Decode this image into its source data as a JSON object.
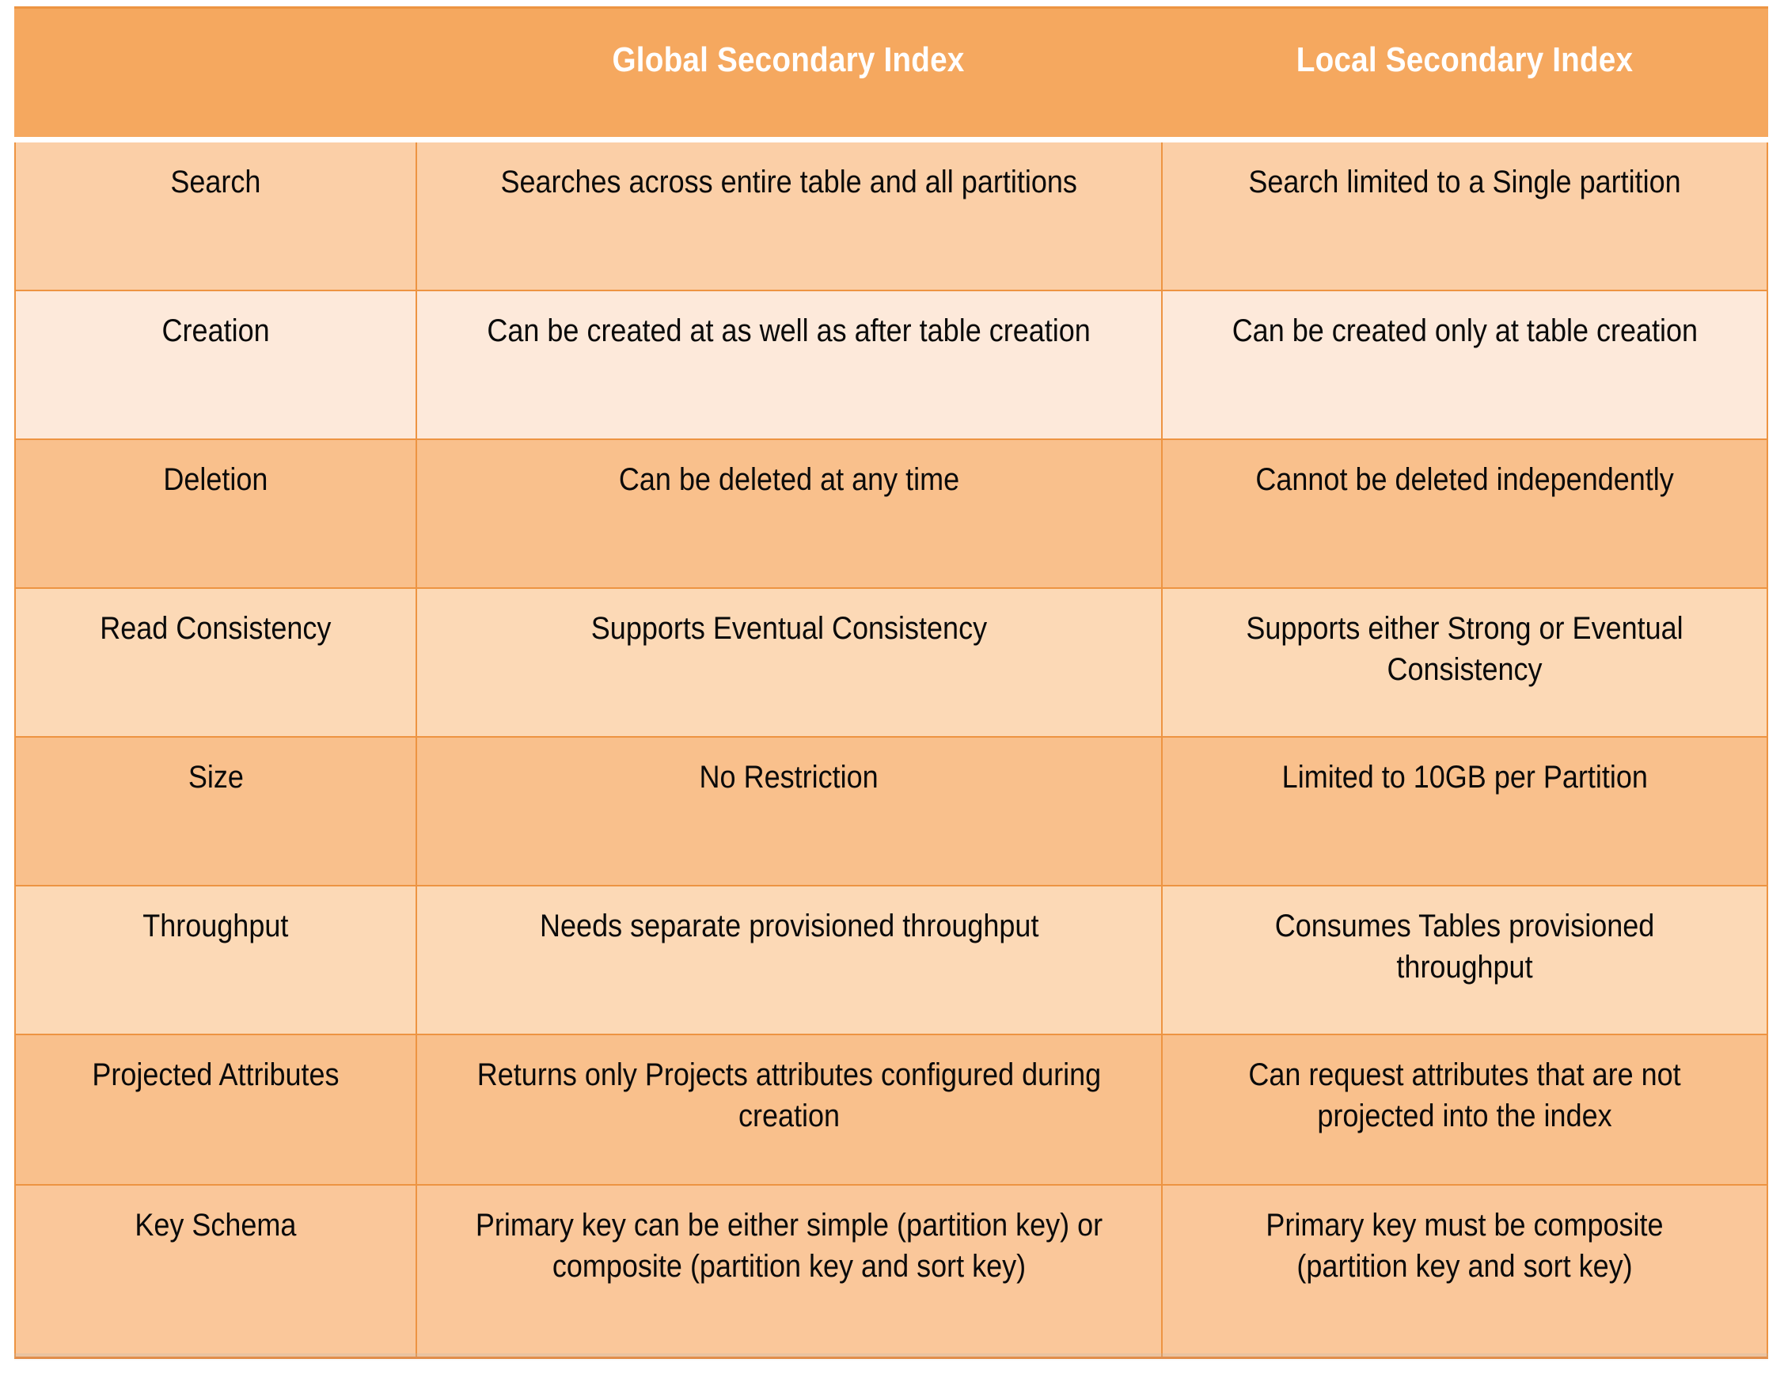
{
  "table": {
    "columns": [
      {
        "key": "feature",
        "label": ""
      },
      {
        "key": "gsi",
        "label": "Global Secondary Index"
      },
      {
        "key": "lsi",
        "label": "Local Secondary Index"
      }
    ],
    "rows": [
      {
        "feature": "Search",
        "gsi": "Searches across entire table and all partitions",
        "lsi": "Search limited to a Single partition"
      },
      {
        "feature": "Creation",
        "gsi": "Can be created at as well as after table creation",
        "lsi": "Can be created only at table creation"
      },
      {
        "feature": "Deletion",
        "gsi": "Can be deleted at any time",
        "lsi": "Cannot be deleted independently"
      },
      {
        "feature": "Read Consistency",
        "gsi": "Supports Eventual Consistency",
        "lsi": "Supports either Strong or Eventual Consistency"
      },
      {
        "feature": "Size",
        "gsi": "No Restriction",
        "lsi": "Limited to 10GB per Partition"
      },
      {
        "feature": "Throughput",
        "gsi": "Needs separate provisioned throughput",
        "lsi": "Consumes Tables provisioned throughput"
      },
      {
        "feature": "Projected Attributes",
        "gsi": "Returns only Projects attributes configured during creation",
        "lsi": "Can request attributes that are not projected into the index"
      },
      {
        "feature": "Key Schema",
        "gsi": "Primary key can be either simple (partition key) or composite (partition key and sort key)",
        "lsi": "Primary key must be composite (partition key and sort key)"
      }
    ]
  },
  "colors": {
    "header_background": "#F5A85F",
    "header_text": "#FFFFFF",
    "border": "#ED9442",
    "row_tone_a": "#FBCFA7",
    "row_tone_b": "#FDE9DA",
    "row_tone_c": "#FCD9B6",
    "row_tone_d": "#F9C08C",
    "row_tone_e": "#FAC79A",
    "body_text": "#0A0A0A"
  }
}
